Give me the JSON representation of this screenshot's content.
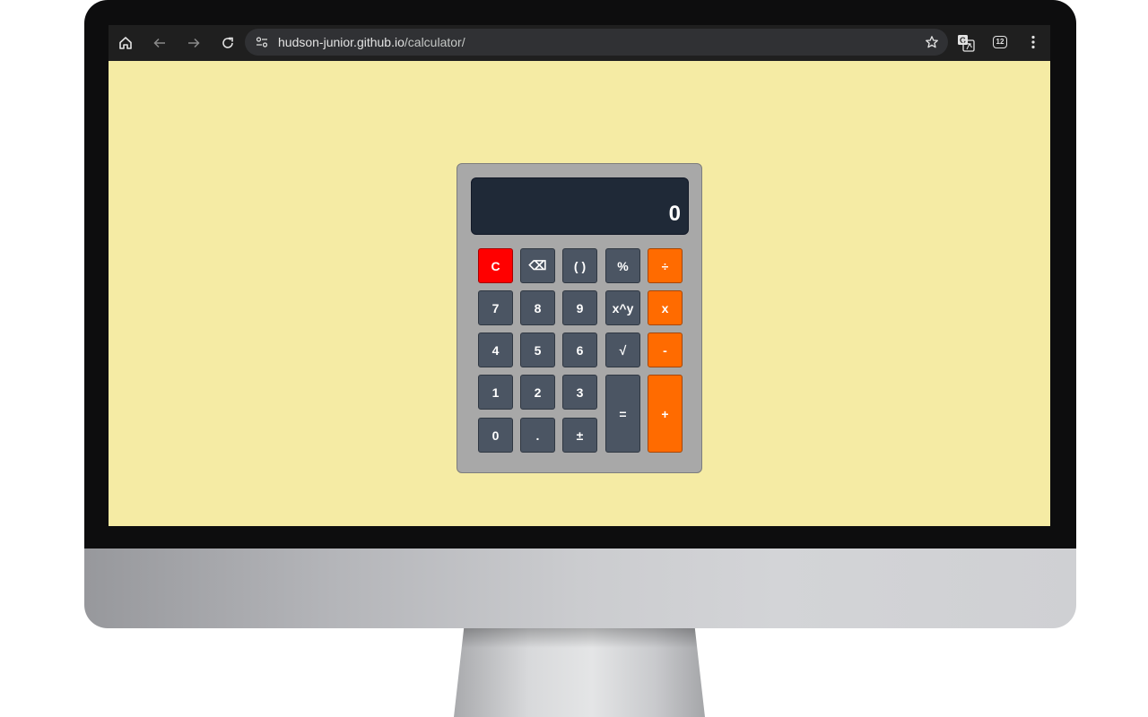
{
  "browser": {
    "home_icon": "home-icon",
    "back_icon": "arrow-left-icon",
    "forward_icon": "arrow-right-icon",
    "reload_icon": "reload-icon",
    "site_info_icon": "tune-icon",
    "url_host": "hudson-junior.github.io",
    "url_path": "/calculator/",
    "bookmark_icon": "star-icon",
    "translate_icon": "translate-icon",
    "tab_count": "12",
    "menu_icon": "kebab-menu-icon"
  },
  "calculator": {
    "display_value": "0",
    "keys": {
      "clear": "C",
      "backspace": "⌫",
      "parentheses": "( )",
      "percent": "%",
      "divide": "÷",
      "seven": "7",
      "eight": "8",
      "nine": "9",
      "power": "x^y",
      "multiply": "x",
      "four": "4",
      "five": "5",
      "six": "6",
      "sqrt": "√",
      "subtract": "-",
      "one": "1",
      "two": "2",
      "three": "3",
      "equals": "=",
      "add": "+",
      "zero": "0",
      "decimal": ".",
      "negate": "±"
    }
  },
  "colors": {
    "page_background": "#f5eba4",
    "display_background": "#1f2937",
    "key_default": "#4b5563",
    "key_clear": "#ff0000",
    "key_operator": "#ff6b00",
    "calculator_body": "#a8a8a8"
  }
}
